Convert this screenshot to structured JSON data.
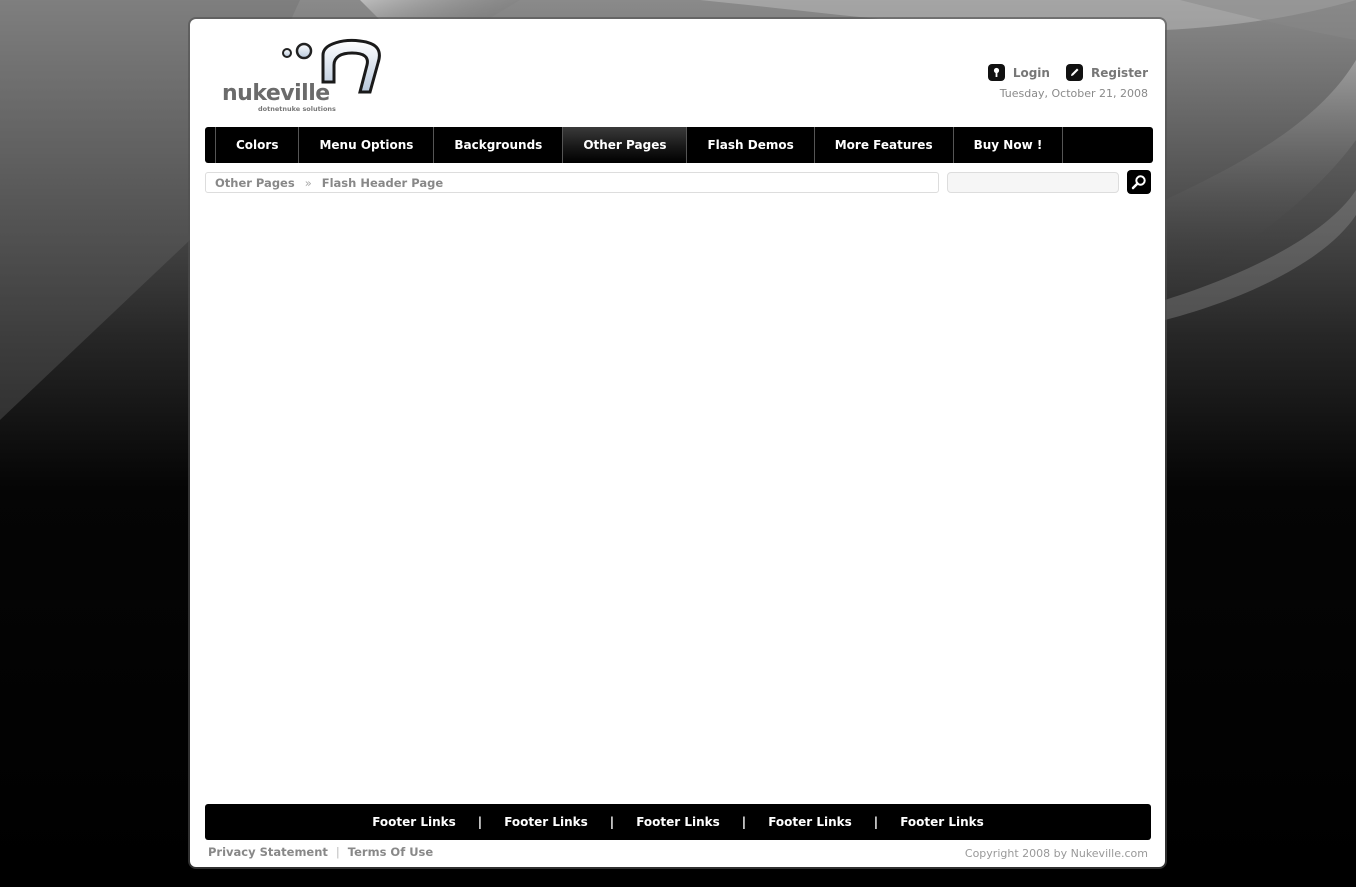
{
  "header": {
    "logo_text": "nukeville",
    "logo_subtext": "dotnetnuke solutions",
    "login_label": "Login",
    "register_label": "Register",
    "date": "Tuesday, October 21, 2008"
  },
  "nav": {
    "items": [
      {
        "label": "Colors"
      },
      {
        "label": "Menu Options"
      },
      {
        "label": "Backgrounds"
      },
      {
        "label": "Other Pages",
        "active": true
      },
      {
        "label": "Flash Demos"
      },
      {
        "label": "More Features"
      },
      {
        "label": "Buy Now !"
      }
    ]
  },
  "breadcrumb": {
    "items": [
      "Other Pages",
      "Flash Header Page"
    ],
    "separator": "»"
  },
  "search": {
    "value": "",
    "icon": "search-icon"
  },
  "footer": {
    "links": [
      "Footer Links",
      "Footer Links",
      "Footer Links",
      "Footer Links",
      "Footer Links"
    ],
    "separator": "|",
    "privacy_label": "Privacy Statement",
    "pipe": "|",
    "terms_label": "Terms Of Use",
    "copyright": "Copyright 2008 by Nukeville.com"
  },
  "colors": {
    "nav_bg": "#000000",
    "page_bg": "#ffffff",
    "muted_text": "#888888"
  }
}
